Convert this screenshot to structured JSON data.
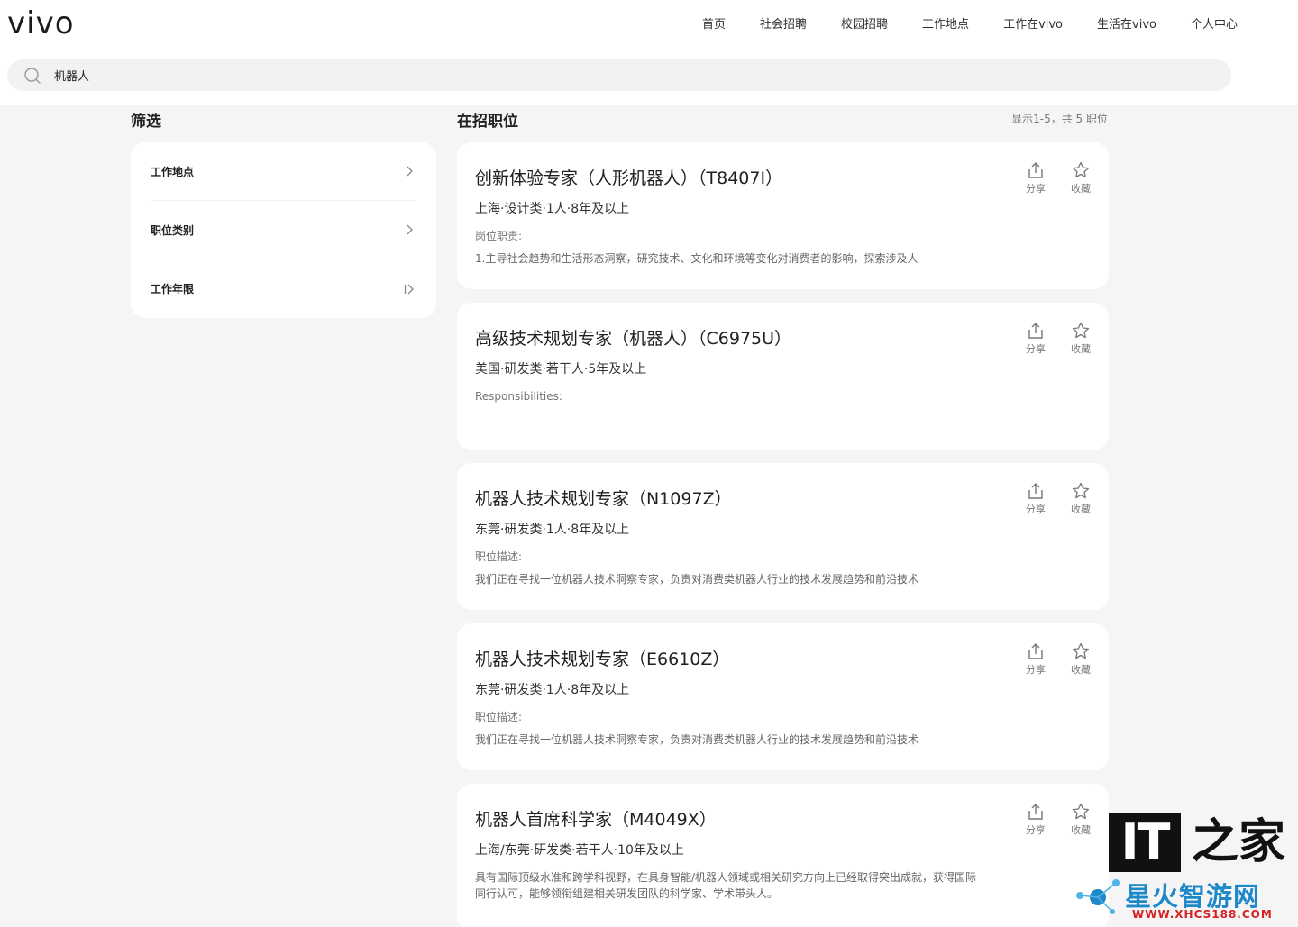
{
  "header": {
    "logo": "vivo",
    "nav": [
      "首页",
      "社会招聘",
      "校园招聘",
      "工作地点",
      "工作在vivo",
      "生活在vivo",
      "个人中心"
    ]
  },
  "search": {
    "value": "机器人",
    "icon": "search-icon"
  },
  "filters": {
    "title": "筛选",
    "items": [
      {
        "label": "工作地点",
        "icon": "chevron-right-icon"
      },
      {
        "label": "职位类别",
        "icon": "chevron-right-icon"
      },
      {
        "label": "工作年限",
        "icon": "chevron-bar-right-icon"
      }
    ]
  },
  "jobs": {
    "title": "在招职位",
    "count_text": "显示1-5，共 5 职位",
    "share_label": "分享",
    "favorite_label": "收藏",
    "items": [
      {
        "title": "创新体验专家（人形机器人）（T8407I）",
        "meta": "上海·设计类·1人·8年及以上",
        "desc_label": "岗位职责:",
        "desc": "1.主导社会趋势和生活形态洞察，研究技术、文化和环境等变化对消费者的影响，探索涉及人"
      },
      {
        "title": "高级技术规划专家（机器人）（C6975U）",
        "meta": "美国·研发类·若干人·5年及以上",
        "desc_label": "Responsibilities:",
        "desc": ""
      },
      {
        "title": "机器人技术规划专家（N1097Z）",
        "meta": "东莞·研发类·1人·8年及以上",
        "desc_label": "职位描述:",
        "desc": "我们正在寻找一位机器人技术洞察专家，负责对消费类机器人行业的技术发展趋势和前沿技术"
      },
      {
        "title": "机器人技术规划专家（E6610Z）",
        "meta": "东莞·研发类·1人·8年及以上",
        "desc_label": "职位描述:",
        "desc": "我们正在寻找一位机器人技术洞察专家，负责对消费类机器人行业的技术发展趋势和前沿技术"
      },
      {
        "title": "机器人首席科学家（M4049X）",
        "meta": "上海/东莞·研发类·若干人·10年及以上",
        "desc_label": "",
        "desc": "具有国际顶级水准和跨学科视野，在具身智能/机器人领域或相关研究方向上已经取得突出成就，获得国际同行认可，能够领衔组建相关研发团队的科学家、学术带头人。"
      }
    ]
  },
  "watermark": {
    "it": "IT",
    "home": "之家",
    "cn": "星火智游网",
    "url": "WWW.XHCS188.COM"
  },
  "colors": {
    "accent_blue": "#1e88c9",
    "watermark_red": "#d62222",
    "background": "#f5f5f5"
  }
}
